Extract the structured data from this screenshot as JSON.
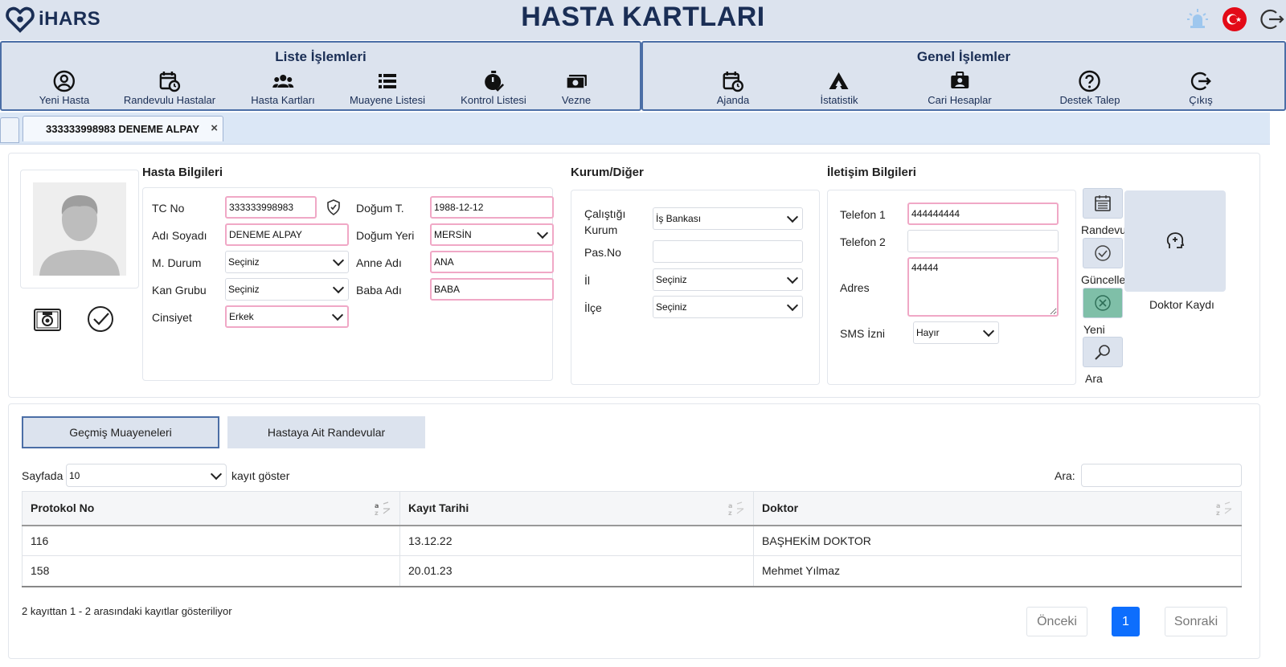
{
  "header": {
    "logo_text": "iHARS",
    "title": "HASTA KARTLARI",
    "icons": [
      "alarm-light-icon",
      "turkey-flag-icon",
      "logout-icon"
    ]
  },
  "menus": {
    "left_title": "Liste İşlemleri",
    "left_items": [
      "Yeni Hasta",
      "Randevulu Hastalar",
      "Hasta Kartları",
      "Muayene Listesi",
      "Kontrol Listesi",
      "Vezne"
    ],
    "right_title": "Genel İşlemler",
    "right_items": [
      "Ajanda",
      "İstatistik",
      "Cari Hesaplar",
      "Destek Talep",
      "Çıkış"
    ]
  },
  "tabs": {
    "active_label": "333333998983 DENEME ALPAY",
    "close": "×"
  },
  "patient": {
    "section_title": "Hasta Bilgileri",
    "tc_label": "TC No",
    "tc_value": "333333998983",
    "name_label": "Adı Soyadı",
    "name_value": "DENEME ALPAY",
    "marital_label": "M. Durum",
    "marital_value": "Seçiniz",
    "blood_label": "Kan Grubu",
    "blood_value": "Seçiniz",
    "gender_label": "Cinsiyet",
    "gender_value": "Erkek",
    "birthdate_label": "Doğum T.",
    "birthdate_value": "1988-12-12",
    "birthplace_label": "Doğum Yeri",
    "birthplace_value": "MERSİN",
    "mother_label": "Anne Adı",
    "mother_value": "ANA",
    "father_label": "Baba Adı",
    "father_value": "BABA"
  },
  "institution": {
    "section_title": "Kurum/Diğer",
    "work_label_1": "Çalıştığı",
    "work_label_2": "Kurum",
    "work_value": "İş Bankası",
    "passport_label": "Pas.No",
    "passport_value": "",
    "city_label": "İl",
    "city_value": "Seçiniz",
    "district_label": "İlçe",
    "district_value": "Seçiniz"
  },
  "contact": {
    "section_title": "İletişim Bilgileri",
    "phone1_label": "Telefon 1",
    "phone1_value": "444444444",
    "phone2_label": "Telefon 2",
    "phone2_value": "",
    "address_label": "Adres",
    "address_value": "44444",
    "sms_label": "SMS İzni",
    "sms_value": "Hayır"
  },
  "actions": {
    "appointment": "Randevu",
    "update": "Güncelle",
    "new": "Yeni",
    "search": "Ara",
    "doctor_record": "Doktor Kaydı"
  },
  "history": {
    "tab_past": "Geçmiş Muayeneleri",
    "tab_appointments": "Hastaya Ait Randevular",
    "page_size_label": "Sayfada",
    "page_size_value": "10",
    "page_size_suffix": "kayıt göster",
    "search_label": "Ara:",
    "search_value": "",
    "columns": [
      "Protokol No",
      "Kayıt Tarihi",
      "Doktor"
    ],
    "rows": [
      [
        "116",
        "13.12.22",
        "BAŞHEKİM DOKTOR"
      ],
      [
        "158",
        "20.01.23",
        "Mehmet Yılmaz"
      ]
    ],
    "info": "2 kayıttan 1 - 2 arasındaki kayıtlar gösteriliyor",
    "prev": "Önceki",
    "page": "1",
    "next": "Sonraki"
  },
  "colors": {
    "header_bg": "#dce3ee",
    "title": "#1a2e55",
    "required_border": "#f0a8c6",
    "accent": "#0d6efd"
  }
}
